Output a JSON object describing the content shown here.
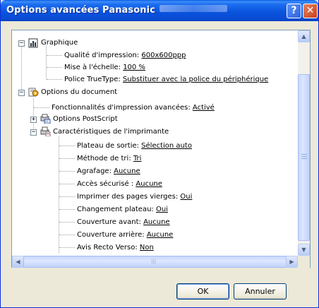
{
  "window": {
    "title": "Options avancées Panasonic",
    "help_button": "?",
    "close_button": "✕"
  },
  "tree": {
    "graphique": {
      "label": "Graphique",
      "items": [
        {
          "label": "Qualité d'impression: ",
          "value": "600x600ppp"
        },
        {
          "label": "Mise à l'échelle: ",
          "value": "100 %"
        },
        {
          "label": "Police TrueType: ",
          "value": "Substituer avec la police du périphérique"
        }
      ]
    },
    "document": {
      "label": "Options du document",
      "fonctionnalites": {
        "label": "Fonctionnalités d'impression avancées: ",
        "value": "Activé"
      },
      "postscript": {
        "label": "Options PostScript"
      },
      "caracteristiques": {
        "label": "Caractéristiques de l'imprimante",
        "items": [
          {
            "label": "Plateau de sortie: ",
            "value": "Sélection auto"
          },
          {
            "label": "Méthode de tri: ",
            "value": "Tri"
          },
          {
            "label": "Agrafage: ",
            "value": "Aucune"
          },
          {
            "label": "Accès sécurisé : ",
            "value": "Aucune"
          },
          {
            "label": "Imprimer des pages vierges: ",
            "value": "Oui"
          },
          {
            "label": "Changement plateau: ",
            "value": "Oui"
          },
          {
            "label": "Couverture avant: ",
            "value": "Aucune"
          },
          {
            "label": "Couverture arrière: ",
            "value": "Aucune"
          },
          {
            "label": "Avis Recto Verso: ",
            "value": "Non"
          }
        ]
      }
    }
  },
  "scrollbar": {
    "up": "▲",
    "down": "▼",
    "left": "◀",
    "right": "▶",
    "hgrip": "|||"
  },
  "buttons": {
    "ok": "OK",
    "cancel": "Annuler"
  },
  "icons": {
    "graphique": "chart-icon",
    "document": "document-options-icon",
    "postscript": "postscript-icon",
    "printer": "printer-features-icon"
  },
  "colors": {
    "titlebar": "#0a54de",
    "window_bg": "#ece9d8",
    "close": "#c7401a"
  }
}
